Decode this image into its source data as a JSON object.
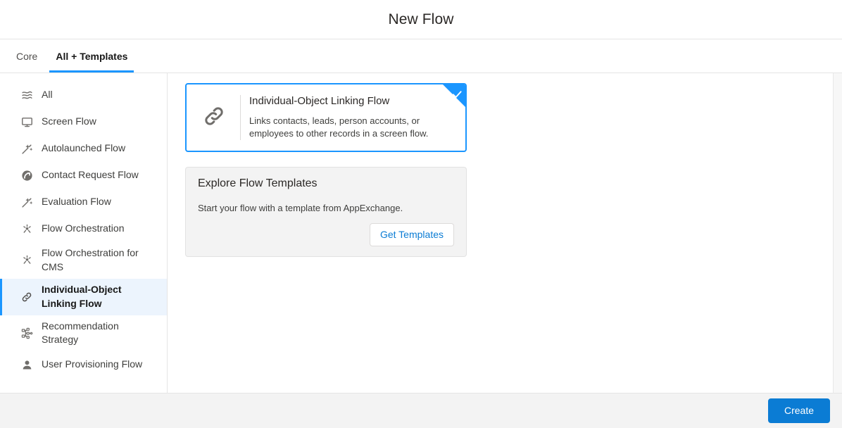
{
  "header": {
    "title": "New Flow"
  },
  "tabs": [
    {
      "label": "Core",
      "active": false
    },
    {
      "label": "All + Templates",
      "active": true
    }
  ],
  "sidebar": {
    "items": [
      {
        "label": "All",
        "icon": "layers-icon",
        "selected": false
      },
      {
        "label": "Screen Flow",
        "icon": "monitor-icon",
        "selected": false
      },
      {
        "label": "Autolaunched Flow",
        "icon": "magic-wand-icon",
        "selected": false
      },
      {
        "label": "Contact Request Flow",
        "icon": "contact-request-icon",
        "selected": false
      },
      {
        "label": "Evaluation Flow",
        "icon": "magic-wand-icon",
        "selected": false
      },
      {
        "label": "Flow Orchestration",
        "icon": "orchestration-icon",
        "selected": false
      },
      {
        "label": "Flow Orchestration for CMS",
        "icon": "orchestration-icon",
        "selected": false
      },
      {
        "label": "Individual-Object Linking Flow",
        "icon": "link-icon",
        "selected": true
      },
      {
        "label": "Recommendation Strategy",
        "icon": "strategy-tree-icon",
        "selected": false
      },
      {
        "label": "User Provisioning Flow",
        "icon": "user-icon",
        "selected": false
      }
    ]
  },
  "main": {
    "flow_card": {
      "title": "Individual-Object Linking Flow",
      "description": "Links contacts, leads, person accounts, or employees to other records in a screen flow.",
      "icon": "link-icon",
      "selected": true,
      "badge_icon": "check-icon"
    },
    "templates_panel": {
      "title": "Explore Flow Templates",
      "subtitle": "Start your flow with a template from AppExchange.",
      "button_label": "Get Templates"
    }
  },
  "footer": {
    "create_label": "Create"
  },
  "colors": {
    "accent_blue": "#1b96ff",
    "brand_blue": "#0b7cd4",
    "selected_row_bg": "#ecf4fd",
    "panel_bg": "#f3f3f3",
    "border": "#e5e5e5",
    "text": "#2b2826"
  }
}
